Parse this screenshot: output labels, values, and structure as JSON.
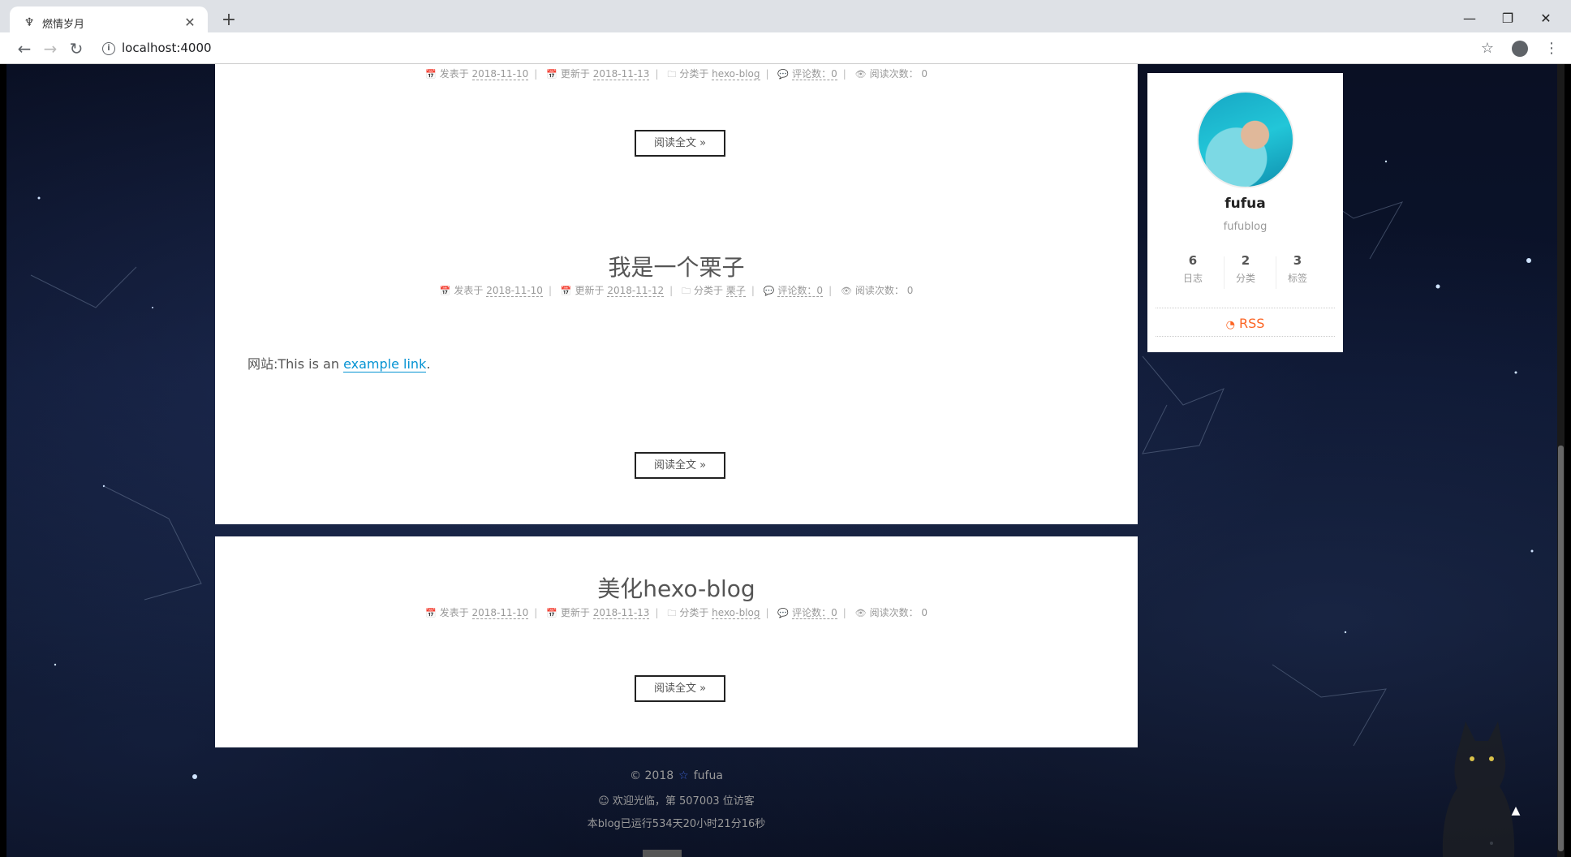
{
  "browser": {
    "tab_title": "燃情岁月",
    "url": "localhost:4000"
  },
  "posts": [
    {
      "meta": {
        "posted_label": "发表于",
        "posted_date": "2018-11-10",
        "updated_label": "更新于",
        "updated_date": "2018-11-13",
        "category_label": "分类于",
        "category": "hexo-blog",
        "comments": "评论数：0",
        "views": "阅读次数： 0"
      },
      "read_more": "阅读全文 »"
    },
    {
      "title": "我是一个栗子",
      "meta": {
        "posted_label": "发表于",
        "posted_date": "2018-11-10",
        "updated_label": "更新于",
        "updated_date": "2018-11-12",
        "category_label": "分类于",
        "category": "栗子",
        "comments": "评论数：0",
        "views": "阅读次数： 0"
      },
      "body_prefix": "网站:This is an ",
      "body_link": "example link",
      "body_suffix": ".",
      "read_more": "阅读全文 »"
    },
    {
      "title": "美化hexo-blog",
      "meta": {
        "posted_label": "发表于",
        "posted_date": "2018-11-10",
        "updated_label": "更新于",
        "updated_date": "2018-11-13",
        "category_label": "分类于",
        "category": "hexo-blog",
        "comments": "评论数：0",
        "views": "阅读次数： 0"
      },
      "read_more": "阅读全文 »"
    }
  ],
  "sidebar": {
    "name": "fufua",
    "description": "fufublog",
    "stats": [
      {
        "count": "6",
        "label": "日志"
      },
      {
        "count": "2",
        "label": "分类"
      },
      {
        "count": "3",
        "label": "标签"
      }
    ],
    "rss": "RSS"
  },
  "footer": {
    "copyright": "© 2018",
    "author": "fufua",
    "visitors": "☺ 欢迎光临，第 507003 位访客",
    "runtime": "本blog已运行534天20小时21分16秒"
  },
  "colors": {
    "accent_link": "#0593d3",
    "rss": "#fc6423",
    "footer_star": "#3a5fcd"
  },
  "icons": [
    "calendar-icon",
    "calendar-check-icon",
    "folder-icon",
    "comment-icon",
    "eye-icon",
    "rss-icon",
    "star-icon",
    "arrow-up-icon"
  ]
}
